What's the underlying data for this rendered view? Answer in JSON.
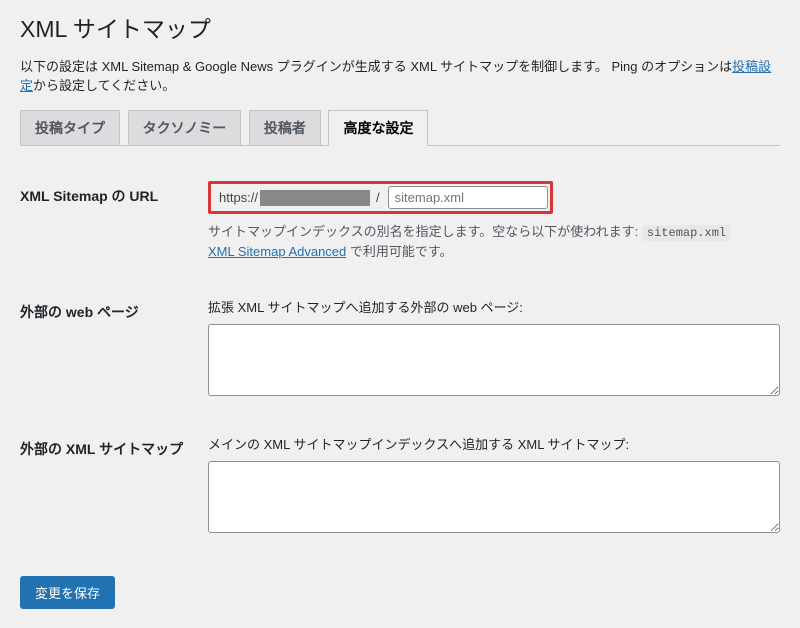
{
  "page_title": "XML サイトマップ",
  "page_description_prefix": "以下の設定は XML Sitemap & Google News プラグインが生成する XML サイトマップを制御します。 Ping のオプションは",
  "page_description_link": "投稿設定",
  "page_description_suffix": "から設定してください。",
  "tabs": [
    {
      "label": "投稿タイプ"
    },
    {
      "label": "タクソノミー"
    },
    {
      "label": "投稿者"
    },
    {
      "label": "高度な設定"
    }
  ],
  "active_tab_index": 3,
  "fields": {
    "sitemap_url": {
      "label": "XML Sitemap の URL",
      "prefix": "https://",
      "slash": "/",
      "placeholder": "sitemap.xml",
      "value": "",
      "description_part1": "サイトマップインデックスの別名を指定します。空なら以下が使われます: ",
      "description_code": "sitemap.xml",
      "description_link_text": "XML Sitemap Advanced",
      "description_part2": " で利用可能です。"
    },
    "external_pages": {
      "label": "外部の web ページ",
      "field_caption": "拡張 XML サイトマップへ追加する外部の web ページ:",
      "value": ""
    },
    "external_sitemaps": {
      "label": "外部の XML サイトマップ",
      "field_caption": "メインの XML サイトマップインデックスへ追加する XML サイトマップ:",
      "value": ""
    }
  },
  "submit_label": "変更を保存"
}
